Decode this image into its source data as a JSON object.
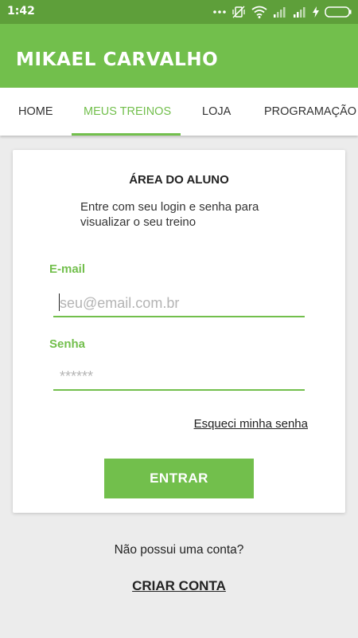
{
  "status_bar": {
    "time": "1:42",
    "icons": [
      "more-dots-icon",
      "vibrate-off-icon",
      "wifi-icon",
      "signal-icon",
      "signal-icon",
      "charging-icon",
      "battery-icon"
    ]
  },
  "app_bar": {
    "title": "MIKAEL CARVALHO"
  },
  "tabs": [
    {
      "label": "HOME",
      "active": false
    },
    {
      "label": "MEUS TREINOS",
      "active": true
    },
    {
      "label": "LOJA",
      "active": false
    },
    {
      "label": "PROGRAMAÇÃO",
      "active": false
    }
  ],
  "login_card": {
    "title": "ÁREA DO ALUNO",
    "subtitle": "Entre com seu login e senha para visualizar o seu treino",
    "email_label": "E-mail",
    "email_placeholder": "seu@email.com.br",
    "email_value": "",
    "password_label": "Senha",
    "password_placeholder": "******",
    "password_value": "",
    "forgot_link": "Esqueci minha senha",
    "submit_label": "ENTRAR"
  },
  "footer": {
    "no_account_text": "Não possui uma conta?",
    "create_account_label": "CRIAR CONTA"
  },
  "colors": {
    "accent": "#72bf4c",
    "status_bar": "#5e9f3a",
    "background": "#ececec"
  }
}
